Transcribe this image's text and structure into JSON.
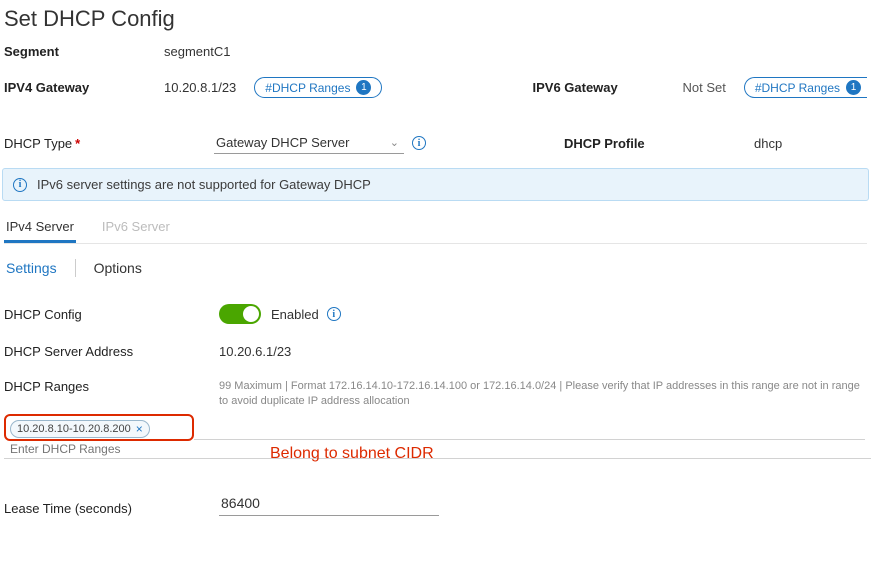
{
  "title": "Set DHCP Config",
  "segment": {
    "label": "Segment",
    "value": "segmentC1"
  },
  "ipv4gw": {
    "label": "IPV4 Gateway",
    "value": "10.20.8.1/23",
    "pill_label": "#DHCP Ranges",
    "pill_count": "1"
  },
  "ipv6gw": {
    "label": "IPV6 Gateway",
    "value": "Not Set",
    "pill_label": "#DHCP Ranges",
    "pill_count": "1"
  },
  "dhcp_type": {
    "label": "DHCP Type",
    "value": "Gateway DHCP Server"
  },
  "dhcp_profile": {
    "label": "DHCP Profile",
    "value": "dhcp"
  },
  "banner": "IPv6 server settings are not supported for Gateway DHCP",
  "tabs": {
    "ipv4": "IPv4 Server",
    "ipv6": "IPv6 Server"
  },
  "subtabs": {
    "settings": "Settings",
    "options": "Options"
  },
  "dhcp_config": {
    "label": "DHCP Config",
    "state": "Enabled"
  },
  "server_addr": {
    "label": "DHCP Server Address",
    "value": "10.20.6.1/23"
  },
  "ranges": {
    "label": "DHCP Ranges",
    "hint": "99 Maximum | Format 172.16.14.10-172.16.14.100 or 172.16.14.0/24 | Please verify that IP addresses in this range are not in range to avoid duplicate IP address allocation",
    "chip": "10.20.8.10-10.20.8.200",
    "placeholder": "Enter DHCP Ranges"
  },
  "annotation": "Belong to subnet CIDR",
  "lease": {
    "label": "Lease Time (seconds)",
    "value": "86400"
  }
}
